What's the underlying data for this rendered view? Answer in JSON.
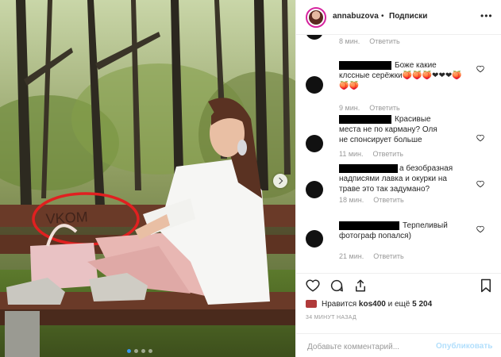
{
  "header": {
    "username": "annabuzova",
    "separator": "•",
    "follow_label": "Подписки",
    "more_icon": "more-dots-icon"
  },
  "comments": [
    {
      "text": "",
      "time": "8 мин.",
      "reply": "Ответить"
    },
    {
      "text": "Боже какие клсcные серёжки🍑🍑🍑❤❤❤🍑🍑🍑",
      "time": "9 мин.",
      "reply": "Ответить"
    },
    {
      "text": "Красивые места не по карману? Оля не спонсирует больше",
      "time": "11 мин.",
      "reply": "Ответить"
    },
    {
      "text": "а безобразная надписями лавка и окурки на траве это так задумано?",
      "time": "18 мин.",
      "reply": "Ответить"
    },
    {
      "text": "Терпеливый фотограф попался)",
      "time": "21 мин.",
      "reply": "Ответить"
    }
  ],
  "actions": {
    "like_icon": "heart-icon",
    "comment_icon": "comment-icon",
    "share_icon": "share-icon",
    "save_icon": "bookmark-icon"
  },
  "likes": {
    "prefix": "Нравится ",
    "user": "kos400",
    "middle": " и ещё ",
    "count": "5 204"
  },
  "timestamp": "34 МИНУТ НАЗАД",
  "add_comment": {
    "placeholder": "Добавьте комментарий...",
    "publish_label": "Опубликовать"
  },
  "photo": {
    "graffiti_text": "VKOM",
    "carousel_total": 4,
    "carousel_active": 1
  },
  "colors": {
    "link_blue": "#3897f0",
    "disabled_blue": "#b2dffc",
    "annotation_red": "#e02020"
  }
}
